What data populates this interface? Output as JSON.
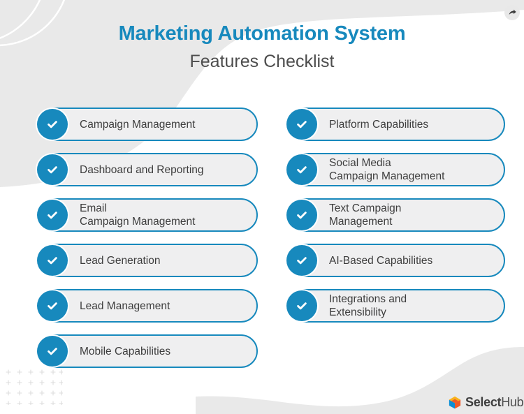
{
  "header": {
    "title": "Marketing Automation System",
    "subtitle": "Features Checklist"
  },
  "colors": {
    "accent_blue": "#1789bd",
    "pill_fill": "#efeff0",
    "text_dark": "#3d3d3d",
    "subtitle_gray": "#4d4d4d",
    "decor_gray": "#e9e9e9",
    "dot_gray": "#dcdcdc",
    "logo_orange": "#ef5a28",
    "logo_yellow": "#f9b21d",
    "logo_blue": "#0b8ed6"
  },
  "toolbar": {
    "share_icon": "share-arrow-icon"
  },
  "checklist": {
    "left_column": [
      {
        "label": "Campaign Management",
        "icon": "check-circle-icon"
      },
      {
        "label": "Dashboard and Reporting",
        "icon": "check-circle-icon"
      },
      {
        "label": "Email\nCampaign Management",
        "icon": "check-circle-icon"
      },
      {
        "label": "Lead Generation",
        "icon": "check-circle-icon"
      },
      {
        "label": "Lead Management",
        "icon": "check-circle-icon"
      },
      {
        "label": "Mobile Capabilities",
        "icon": "check-circle-icon"
      }
    ],
    "right_column": [
      {
        "label": "Platform Capabilities",
        "icon": "check-circle-icon"
      },
      {
        "label": "Social Media\nCampaign Management",
        "icon": "check-circle-icon"
      },
      {
        "label": "Text Campaign\nManagement",
        "icon": "check-circle-icon"
      },
      {
        "label": "AI-Based Capabilities",
        "icon": "check-circle-icon"
      },
      {
        "label": "Integrations and\nExtensibility",
        "icon": "check-circle-icon"
      }
    ]
  },
  "footer": {
    "brand_bold": "Select",
    "brand_light": "Hub",
    "logo_icon": "selecthub-cube-icon"
  },
  "decor": {
    "dot_grid_columns": 6,
    "dot_grid_rows": 4,
    "dot_glyph": "plus-tick-icon"
  }
}
